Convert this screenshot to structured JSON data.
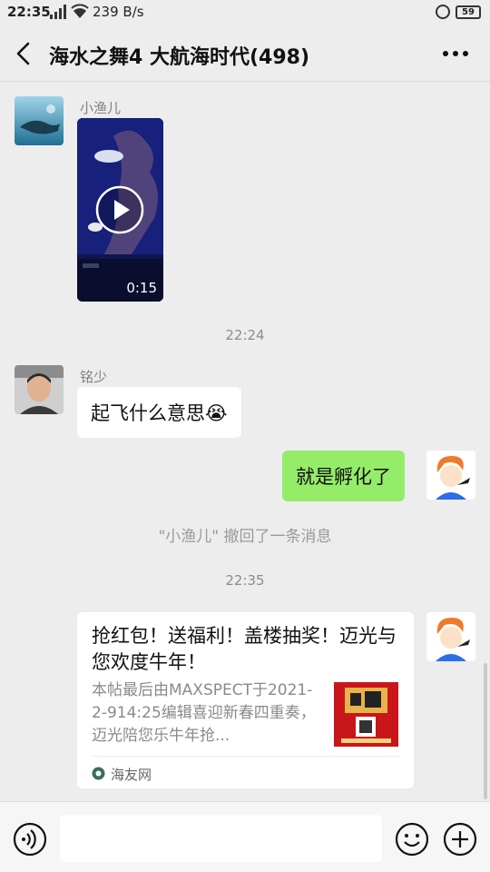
{
  "status_bar": {
    "time": "22:35",
    "network": "239 B/s",
    "battery": "59"
  },
  "header": {
    "title": "海水之舞4 大航海时代(498)",
    "back_icon": "chevron-left-icon",
    "more_icon": "more-dots-icon"
  },
  "messages": [
    {
      "type": "video",
      "sender": "小渔儿",
      "duration": "0:15"
    },
    {
      "type": "time",
      "text": "22:24"
    },
    {
      "type": "text",
      "sender": "铭少",
      "text": "起飞什么意思",
      "emoji": "😭"
    },
    {
      "type": "text",
      "sender": "me",
      "text": "就是孵化了"
    },
    {
      "type": "system",
      "text": "\"小渔儿\" 撤回了一条消息"
    },
    {
      "type": "time",
      "text": "22:35"
    },
    {
      "type": "link_card",
      "sender": "me",
      "title": "抢红包！送福利！盖楼抽奖！迈光与您欢度牛年！",
      "description": "本帖最后由MAXSPECT于2021-2-914:25编辑喜迎新春四重奏，迈光陪您乐牛年抢...",
      "source": "海友网"
    }
  ],
  "input_bar": {
    "voice_icon": "voice-icon",
    "input_value": "",
    "emoji_icon": "emoji-icon",
    "plus_icon": "plus-icon"
  },
  "colors": {
    "background": "#ededed",
    "own_bubble": "#95ec69",
    "other_bubble": "#ffffff",
    "muted_text": "#8c8c8c"
  }
}
